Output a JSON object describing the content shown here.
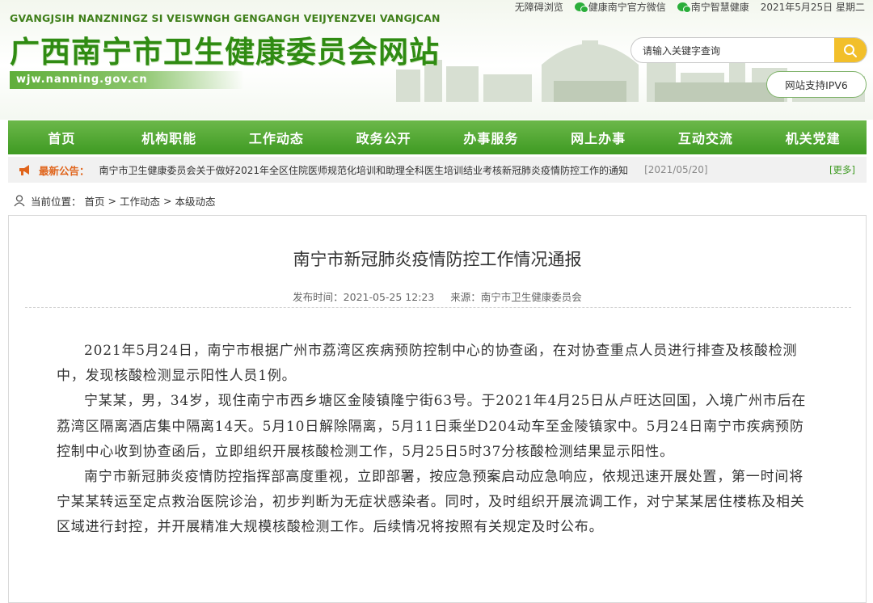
{
  "header": {
    "pinyin": "GVANGJSIH NANZNINGZ SI VEISWNGH GENGANGH VEIJYENZVEI VANGJCAN",
    "site_name": "广西南宁市卫生健康委员会网站",
    "domain": "wjw.nanning.gov.cn",
    "top_links": {
      "accessibility": "无障碍浏览",
      "wechat_official": "健康南宁官方微信",
      "wechat_smart": "南宁智慧健康",
      "date": "2021年5月25日 星期二"
    },
    "search": {
      "placeholder": "请输入关键字查询"
    },
    "ipv6": "网站支持IPV6"
  },
  "nav": {
    "items": [
      {
        "label": "首页"
      },
      {
        "label": "机构职能"
      },
      {
        "label": "工作动态"
      },
      {
        "label": "政务公开"
      },
      {
        "label": "办事服务"
      },
      {
        "label": "网上办事"
      },
      {
        "label": "互动交流"
      },
      {
        "label": "机关党建"
      }
    ]
  },
  "notice": {
    "label": "最新公告：",
    "text": "南宁市卫生健康委员会关于做好2021年全区住院医师规范化培训和助理全科医生培训结业考核新冠肺炎疫情防控工作的通知",
    "date": "[2021/05/20]",
    "more": "[更多]"
  },
  "breadcrumb": {
    "prefix": "当前位置：",
    "items": [
      "首页",
      ">",
      "工作动态",
      ">",
      "本级动态"
    ]
  },
  "article": {
    "title": "南宁市新冠肺炎疫情防控工作情况通报",
    "publish_time": "发布时间：2021-05-25 12:23",
    "source": "来源：南宁市卫生健康委员会",
    "paragraphs": [
      "2021年5月24日，南宁市根据广州市荔湾区疾病预防控制中心的协查函，在对协查重点人员进行排查及核酸检测中，发现核酸检测显示阳性人员1例。",
      "宁某某，男，34岁，现住南宁市西乡塘区金陵镇隆宁街63号。于2021年4月25日从卢旺达回国，入境广州市后在荔湾区隔离酒店集中隔离14天。5月10日解除隔离，5月11日乘坐D204动车至金陵镇家中。5月24日南宁市疾病预防控制中心收到协查函后，立即组织开展核酸检测工作，5月25日5时37分核酸检测结果显示阳性。",
      "南宁市新冠肺炎疫情防控指挥部高度重视，立即部署，按应急预案启动应急响应，依规迅速开展处置，第一时间将宁某某转运至定点救治医院诊治，初步判断为无症状感染者。同时，及时组织开展流调工作，对宁某某居住楼栋及相关区域进行封控，并开展精准大规模核酸检测工作。后续情况将按照有关规定及时公布。"
    ]
  },
  "colors": {
    "brand_green": "#3e9a22",
    "notice_orange": "#e0641b",
    "search_yellow": "#f2bf2a"
  }
}
